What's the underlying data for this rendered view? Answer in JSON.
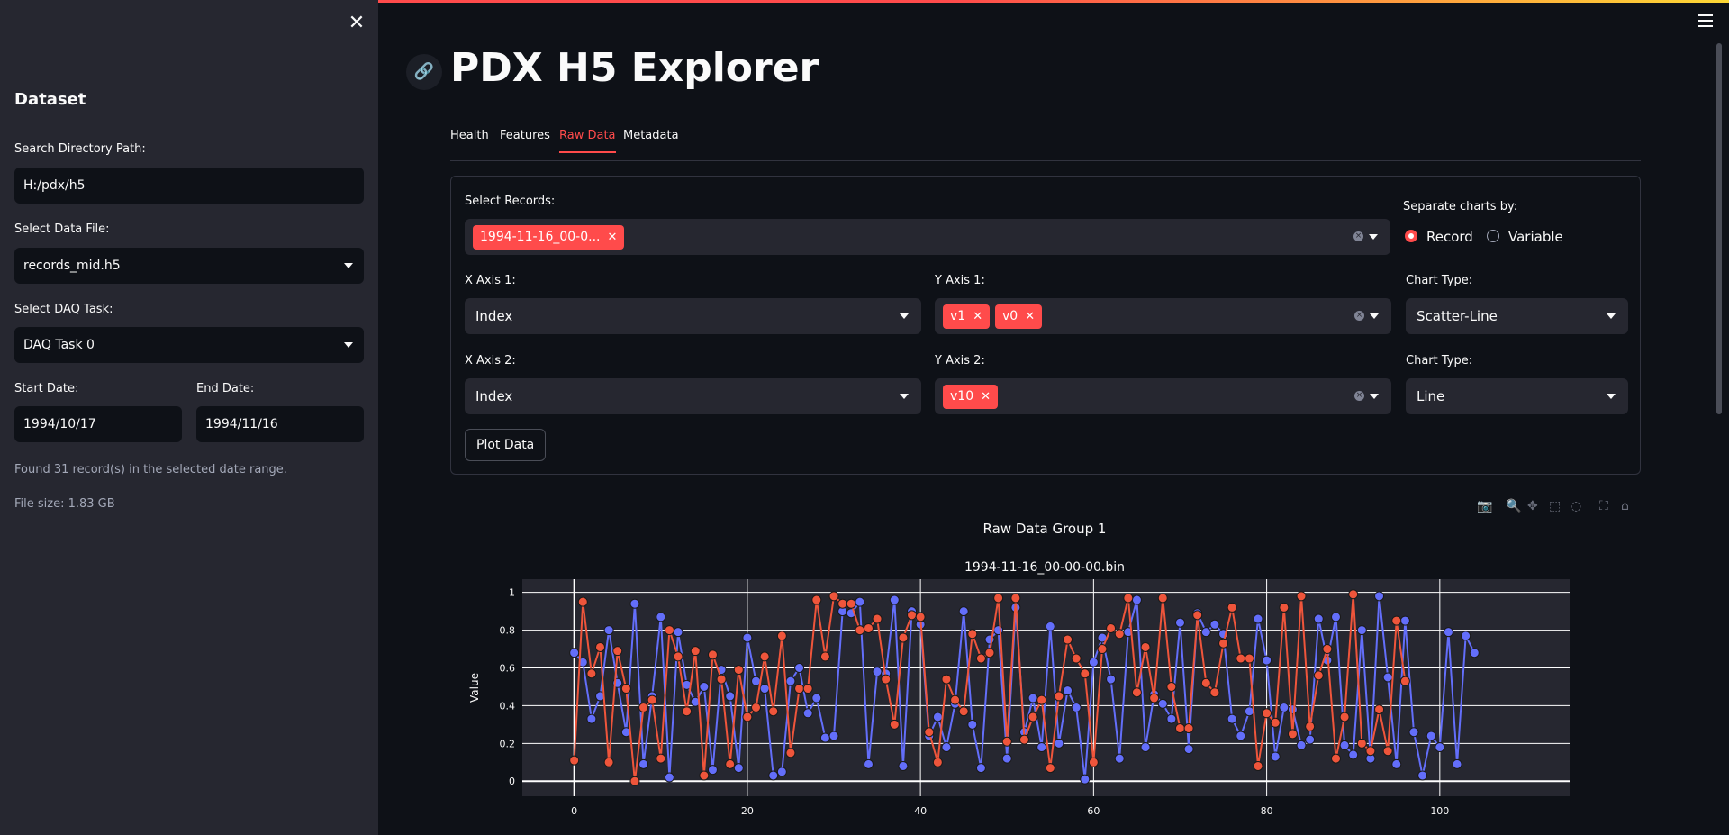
{
  "sidebar": {
    "close_icon": "close-icon",
    "heading": "Dataset",
    "search_label": "Search Directory Path:",
    "search_value": "H:/pdx/h5",
    "file_label": "Select Data File:",
    "file_value": "records_mid.h5",
    "task_label": "Select DAQ Task:",
    "task_value": "DAQ Task 0",
    "start_label": "Start Date:",
    "start_value": "1994/10/17",
    "end_label": "End Date:",
    "end_value": "1994/11/16",
    "found_text": "Found 31 record(s) in the selected date range.",
    "size_text": "File size: 1.83 GB"
  },
  "header": {
    "title": "PDX H5 Explorer",
    "link_icon": "link-icon",
    "menu_icon": "hamburger-icon"
  },
  "tabs": [
    {
      "label": "Health",
      "active": false
    },
    {
      "label": "Features",
      "active": false
    },
    {
      "label": "Raw Data",
      "active": true
    },
    {
      "label": "Metadata",
      "active": false
    }
  ],
  "controls": {
    "records_label": "Select Records:",
    "records_chip": "1994-11-16_00-0...",
    "separate_label": "Separate charts by:",
    "separate_options": [
      "Record",
      "Variable"
    ],
    "separate_selected": "Record",
    "x1_label": "X Axis 1:",
    "x1_value": "Index",
    "y1_label": "Y Axis 1:",
    "y1_chips": [
      "v1",
      "v0"
    ],
    "chart1_label": "Chart Type:",
    "chart1_value": "Scatter-Line",
    "x2_label": "X Axis 2:",
    "x2_value": "Index",
    "y2_label": "Y Axis 2:",
    "y2_chips": [
      "v10"
    ],
    "chart2_label": "Chart Type:",
    "chart2_value": "Line",
    "plot_button": "Plot Data"
  },
  "modebar_icons": [
    "camera-icon",
    "zoom-icon",
    "pan-icon",
    "box-select-icon",
    "lasso-icon",
    "autoscale-icon",
    "home-icon"
  ],
  "colors": {
    "accent": "#ff4b4b",
    "series_v1": "#636efa",
    "series_v0": "#ef553b",
    "plot_bg": "#262730"
  },
  "chart_data": {
    "type": "line",
    "group_title": "Raw Data Group 1",
    "title": "1994-11-16_00-00-00.bin",
    "ylabel": "Value",
    "xlim": [
      -6,
      115
    ],
    "ylim": [
      -0.08,
      1.07
    ],
    "x_ticks": [
      0,
      20,
      40,
      60,
      80,
      100
    ],
    "y_ticks": [
      0,
      0.2,
      0.4,
      0.6,
      0.8,
      1
    ],
    "y_tick_labels": [
      "0",
      "0.2",
      "0.4",
      "0.6",
      "0.8",
      "1"
    ],
    "grid": true,
    "series": [
      {
        "name": "v1",
        "color": "#636efa",
        "values": [
          0.68,
          0.63,
          0.33,
          0.45,
          0.8,
          0.52,
          0.26,
          0.94,
          0.09,
          0.45,
          0.87,
          0.02,
          0.79,
          0.51,
          0.42,
          0.5,
          0.06,
          0.59,
          0.45,
          0.07,
          0.76,
          0.53,
          0.49,
          0.03,
          0.05,
          0.53,
          0.6,
          0.36,
          0.44,
          0.23,
          0.24,
          0.9,
          0.89,
          0.95,
          0.09,
          0.58,
          0.57,
          0.96,
          0.08,
          0.9,
          0.83,
          0.24,
          0.34,
          0.18,
          0.41,
          0.9,
          0.3,
          0.07,
          0.75,
          0.8,
          0.12,
          0.92,
          0.26,
          0.44,
          0.18,
          0.82,
          0.2,
          0.48,
          0.39,
          0.01,
          0.63,
          0.76,
          0.54,
          0.12,
          0.79,
          0.96,
          0.18,
          0.46,
          0.41,
          0.33,
          0.84,
          0.17,
          0.89,
          0.79,
          0.83,
          0.78,
          0.33,
          0.24,
          0.37,
          0.86,
          0.64,
          0.13,
          0.39,
          0.38,
          0.19,
          0.22,
          0.86,
          0.64,
          0.87,
          0.19,
          0.14,
          0.8,
          0.12,
          0.98,
          0.55,
          0.09,
          0.85,
          0.26,
          0.03,
          0.24,
          0.18,
          0.79,
          0.09,
          0.77,
          0.68
        ]
      },
      {
        "name": "v0",
        "color": "#ef553b",
        "values": [
          0.11,
          0.95,
          0.57,
          0.71,
          0.1,
          0.69,
          0.49,
          0.0,
          0.39,
          0.43,
          0.12,
          0.8,
          0.66,
          0.37,
          0.69,
          0.03,
          0.67,
          0.54,
          0.09,
          0.59,
          0.34,
          0.39,
          0.66,
          0.37,
          0.77,
          0.15,
          0.49,
          0.49,
          0.96,
          0.66,
          0.98,
          0.94,
          0.94,
          0.8,
          0.81,
          0.86,
          0.54,
          0.3,
          0.76,
          0.88,
          0.87,
          0.26,
          0.1,
          0.54,
          0.43,
          0.37,
          0.78,
          0.65,
          0.68,
          0.97,
          0.21,
          0.97,
          0.22,
          0.34,
          0.43,
          0.07,
          0.45,
          0.75,
          0.65,
          0.57,
          0.1,
          0.7,
          0.81,
          0.78,
          0.97,
          0.47,
          0.71,
          0.44,
          0.97,
          0.5,
          0.28,
          0.28,
          0.88,
          0.52,
          0.47,
          0.73,
          0.92,
          0.65,
          0.65,
          0.08,
          0.36,
          0.31,
          0.92,
          0.25,
          0.98,
          0.29,
          0.56,
          0.7,
          0.12,
          0.34,
          0.99,
          0.2,
          0.16,
          0.38,
          0.16,
          0.85,
          0.53
        ]
      }
    ]
  }
}
